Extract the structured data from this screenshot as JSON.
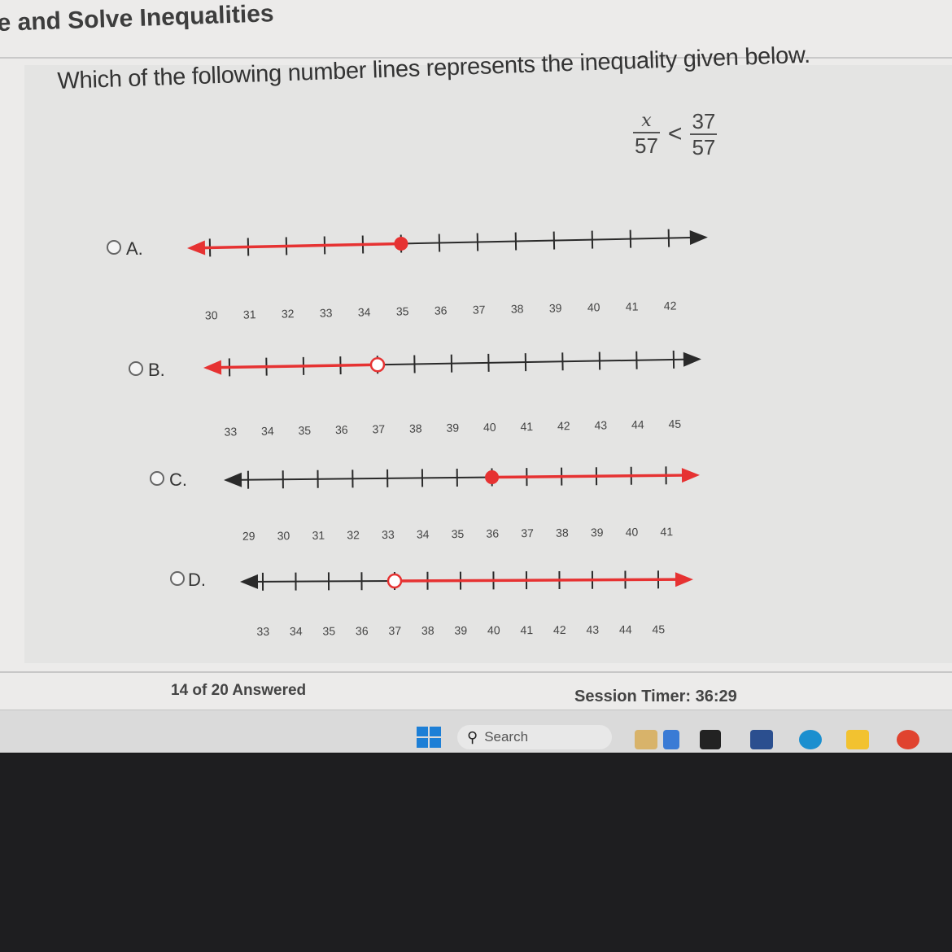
{
  "page": {
    "title": "e and Solve Inequalities",
    "question": "Which of the following number lines represents the inequality given below.",
    "inequality": {
      "lhs_numerator": "x",
      "lhs_denominator": "57",
      "operator": "<",
      "rhs_numerator": "37",
      "rhs_denominator": "57"
    }
  },
  "options": [
    {
      "label": "A.",
      "ticks": [
        "30",
        "31",
        "32",
        "33",
        "34",
        "35",
        "36",
        "37",
        "38",
        "39",
        "40",
        "41",
        "42"
      ],
      "point_value": 35,
      "point_style": "closed",
      "shade": "left"
    },
    {
      "label": "B.",
      "ticks": [
        "33",
        "34",
        "35",
        "36",
        "37",
        "38",
        "39",
        "40",
        "41",
        "42",
        "43",
        "44",
        "45"
      ],
      "point_value": 37,
      "point_style": "open",
      "shade": "left"
    },
    {
      "label": "C.",
      "ticks": [
        "29",
        "30",
        "31",
        "32",
        "33",
        "34",
        "35",
        "36",
        "37",
        "38",
        "39",
        "40",
        "41"
      ],
      "point_value": 36,
      "point_style": "closed",
      "shade": "right"
    },
    {
      "label": "D.",
      "ticks": [
        "33",
        "34",
        "35",
        "36",
        "37",
        "38",
        "39",
        "40",
        "41",
        "42",
        "43",
        "44",
        "45"
      ],
      "point_value": 37,
      "point_style": "open",
      "shade": "right"
    }
  ],
  "footer": {
    "answered": "14 of 20 Answered",
    "timer": "Session Timer: 36:29"
  },
  "taskbar": {
    "search_label": "Search",
    "search_glyph": "⚲"
  },
  "colors": {
    "shade": "#e63232",
    "axis": "#2a2a2a"
  }
}
